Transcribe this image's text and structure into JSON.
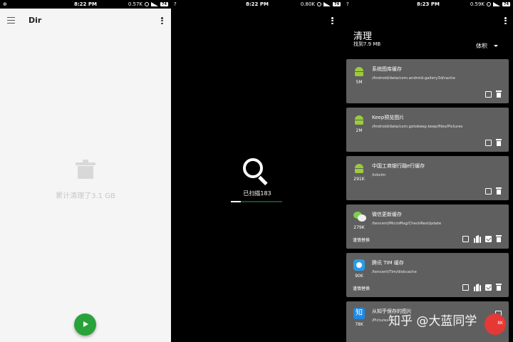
{
  "status": [
    {
      "left": "⊕",
      "time": "8:22 PM",
      "speed": "0.57K",
      "battery": "74"
    },
    {
      "left": "?",
      "time": "8:22 PM",
      "speed": "0.80K",
      "battery": "74"
    },
    {
      "left": "?",
      "time": "8:23 PM",
      "speed": "0.59K",
      "battery": "74"
    }
  ],
  "screen1": {
    "title": "Dir",
    "cleaned_text": "累计清理了3.1 GB"
  },
  "screen2": {
    "scanned_text": "已扫描183",
    "progress": 0.2
  },
  "screen3": {
    "title": "清理",
    "found": "找到7.9 MB",
    "sort": "体积",
    "cards": [
      {
        "icon": "android-icon",
        "size": "5M",
        "name": "系统图库缓存",
        "path": "/Android/data/com.android.gallery3d/cache",
        "note": ""
      },
      {
        "icon": "android-icon",
        "size": "2M",
        "name": "Keep预览图片",
        "path": "/Android/data/com.gotokeep.keep/files/Pictures",
        "note": ""
      },
      {
        "icon": "android-icon",
        "size": "291K",
        "name": "中国工商银行融e行缓存",
        "path": "/icbcim",
        "note": ""
      },
      {
        "icon": "wechat-icon",
        "size": "279K",
        "name": "微信更新缓存",
        "path": "/tencent/MicroMsg/CheckResUpdate",
        "note": "谨慎替换"
      },
      {
        "icon": "tim-icon",
        "size": "90K",
        "name": "腾讯 TIM 缓存",
        "path": "/tencent/Tim/diskcache",
        "note": "谨慎替换"
      },
      {
        "icon": "zhihu-icon",
        "size": "78K",
        "name": "从知乎保存的图片",
        "path": "/Pictures",
        "note": ""
      }
    ],
    "zhihu_glyph": "知",
    "fab_text": "8K"
  },
  "watermark": "知乎 @大蓝同学"
}
